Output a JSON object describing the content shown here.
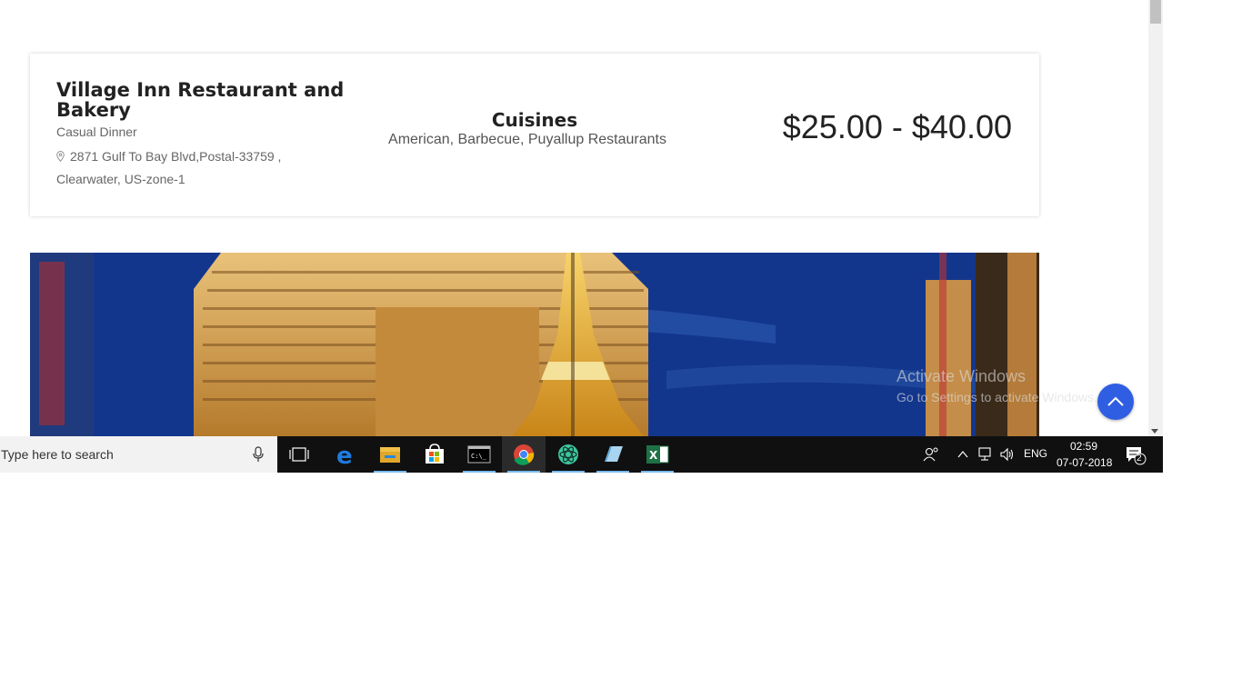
{
  "restaurant": {
    "name": "Village Inn Restaurant and Bakery",
    "category": "Casual Dinner",
    "address_line1": "2871 Gulf To Bay Blvd,Postal-33759 ,",
    "address_line2": "Clearwater, US-zone-1",
    "cuisines_heading": "Cuisines",
    "cuisines": "American, Barbecue, Puyallup Restaurants",
    "price_range": "$25.00 - $40.00"
  },
  "banner": {
    "description_icon": "las-vegas-paris-hotel-photo"
  },
  "watermark": {
    "line1": "Activate Windows",
    "line2": "Go to Settings to activate Windows."
  },
  "back_to_top": {
    "icon": "chevron-up-icon",
    "color": "#2f5ee3"
  },
  "taskbar": {
    "search_placeholder": "Type here to search",
    "apps": [
      "task-view-icon",
      "edge-icon",
      "file-explorer-icon",
      "store-icon",
      "terminal-icon",
      "chrome-icon",
      "atom-icon",
      "notepad-icon",
      "excel-icon"
    ],
    "tray": {
      "language": "ENG",
      "time": "02:59",
      "date": "07-07-2018",
      "notification_count": "2"
    }
  },
  "colors": {
    "accent": "#2f5ee3",
    "taskbar": "#101010",
    "taskbar_underline": "#76b9ed"
  }
}
